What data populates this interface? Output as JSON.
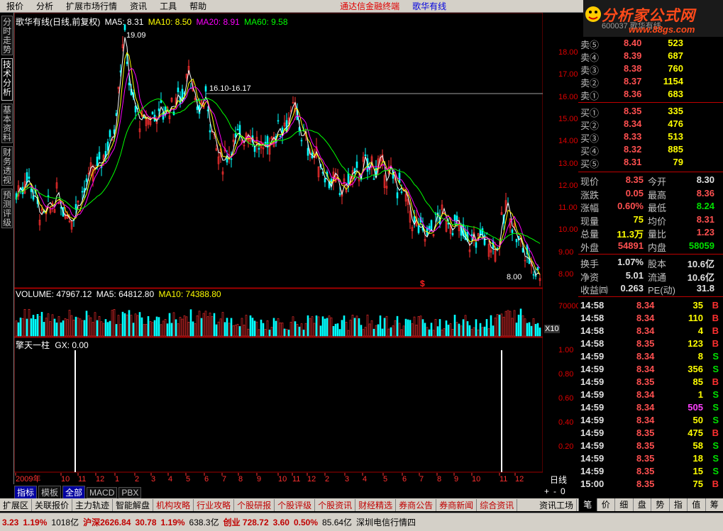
{
  "menu": {
    "items": [
      "报价",
      "分析",
      "扩展市场行情",
      "资讯",
      "工具",
      "帮助"
    ],
    "ad1": "通达信金融终端",
    "ad2": "歌华有线"
  },
  "logo": {
    "main": "分析家公式网",
    "url": "www.88gs.com",
    "sub": "600037 歌华有线"
  },
  "side_tabs": [
    {
      "label": "分时走势"
    },
    {
      "label": "技术分析",
      "active": true
    },
    {
      "label": "基本资料"
    },
    {
      "label": "财务透视"
    },
    {
      "label": "预测评级"
    }
  ],
  "kline": {
    "header_name": "歌华有线(日线,前复权)",
    "ma5": "MA5: 8.31",
    "ma10": "MA10: 8.50",
    "ma20": "MA20: 8.91",
    "ma60": "MA60: 9.58",
    "high_mark": "19.09",
    "range_mark": "16.10-16.17",
    "low_mark": "8.00",
    "colors": {
      "ma5": "#ffffff",
      "ma10": "#ffff00",
      "ma20": "#ff00ff",
      "ma60": "#00ff00",
      "up": "#ff3030",
      "down": "#00ffff"
    },
    "y_ticks": [
      "18.00",
      "17.00",
      "16.00",
      "15.00",
      "14.00",
      "13.00",
      "12.00",
      "11.00",
      "10.00",
      "9.00",
      "8.00"
    ]
  },
  "volume": {
    "label": "VOLUME: 47967.12",
    "ma5": "MA5: 64812.80",
    "ma10": "MA10: 74388.80",
    "tick": "70000",
    "unit": "X10"
  },
  "indicator": {
    "name": "擎天一柱",
    "gx": "GX: 0.00",
    "ticks": [
      "1.00",
      "0.80",
      "0.60",
      "0.40",
      "0.20"
    ]
  },
  "time_axis": {
    "labels": [
      "2009年",
      "10",
      "11",
      "12",
      "1",
      "2",
      "3",
      "4",
      "5",
      "6",
      "7",
      "8",
      "9",
      "10",
      "11",
      "12",
      "2",
      "3",
      "4",
      "5",
      "6",
      "7",
      "8",
      "9",
      "10",
      "11",
      "12"
    ]
  },
  "period": "日线",
  "zoom": [
    "+",
    "-",
    "0"
  ],
  "bottom_tabs": [
    {
      "label": "指标",
      "active": true
    },
    {
      "label": "模板"
    },
    {
      "label": "全部",
      "active": true
    },
    {
      "label": "MACD"
    },
    {
      "label": "PBX"
    }
  ],
  "function_tabs": [
    "扩展区",
    "关联报价",
    "主力轨迹",
    "智能解盘",
    "机构攻略",
    "行业攻略",
    "个股研报",
    "个股评级",
    "个股资讯",
    "财经精选",
    "券商公告",
    "券商新闻",
    "综合资讯",
    "资讯工场"
  ],
  "right_tabs": [
    {
      "label": "笔",
      "active": true
    },
    {
      "label": "价"
    },
    {
      "label": "细"
    },
    {
      "label": "盘"
    },
    {
      "label": "势"
    },
    {
      "label": "指"
    },
    {
      "label": "值"
    },
    {
      "label": "筹"
    }
  ],
  "orderbook": {
    "asks": [
      {
        "label": "卖⑤",
        "price": "8.40",
        "vol": "523"
      },
      {
        "label": "卖④",
        "price": "8.39",
        "vol": "687"
      },
      {
        "label": "卖③",
        "price": "8.38",
        "vol": "760"
      },
      {
        "label": "卖②",
        "price": "8.37",
        "vol": "1154"
      },
      {
        "label": "卖①",
        "price": "8.36",
        "vol": "683"
      }
    ],
    "bids": [
      {
        "label": "买①",
        "price": "8.35",
        "vol": "335"
      },
      {
        "label": "买②",
        "price": "8.34",
        "vol": "476"
      },
      {
        "label": "买③",
        "price": "8.33",
        "vol": "513"
      },
      {
        "label": "买④",
        "price": "8.32",
        "vol": "885"
      },
      {
        "label": "买⑤",
        "price": "8.31",
        "vol": "79"
      }
    ]
  },
  "quote": {
    "rows": [
      {
        "l1": "现价",
        "v1": "8.35",
        "l2": "今开",
        "v2": "8.30",
        "c1": "pr",
        "c2": "wht"
      },
      {
        "l1": "涨跌",
        "v1": "0.05",
        "l2": "最高",
        "v2": "8.36",
        "c1": "pr",
        "c2": "pr"
      },
      {
        "l1": "涨幅",
        "v1": "0.60%",
        "l2": "最低",
        "v2": "8.24",
        "c1": "pr",
        "c2": "grn"
      },
      {
        "l1": "现量",
        "v1": "75",
        "l2": "均价",
        "v2": "8.31",
        "c1": "vol",
        "c2": "pr"
      },
      {
        "l1": "总量",
        "v1": "11.3万",
        "l2": "量比",
        "v2": "1.23",
        "c1": "vol",
        "c2": "pr"
      },
      {
        "l1": "外盘",
        "v1": "54891",
        "l2": "内盘",
        "v2": "58059",
        "c1": "pr",
        "c2": "grn"
      }
    ],
    "rows2": [
      {
        "l1": "换手",
        "v1": "1.07%",
        "l2": "股本",
        "v2": "10.6亿"
      },
      {
        "l1": "净资",
        "v1": "5.01",
        "l2": "流通",
        "v2": "10.6亿"
      },
      {
        "l1": "收益㈣",
        "v1": "0.263",
        "l2": "PE(动)",
        "v2": "31.8"
      }
    ]
  },
  "ticks": [
    {
      "t": "14:58",
      "p": "8.34",
      "v": "35",
      "s": "B",
      "vc": "vol"
    },
    {
      "t": "14:58",
      "p": "8.34",
      "v": "110",
      "s": "B",
      "vc": "vol"
    },
    {
      "t": "14:58",
      "p": "8.34",
      "v": "4",
      "s": "B",
      "vc": "vol"
    },
    {
      "t": "14:58",
      "p": "8.35",
      "v": "123",
      "s": "B",
      "vc": "vol"
    },
    {
      "t": "14:59",
      "p": "8.34",
      "v": "8",
      "s": "S",
      "vc": "vol"
    },
    {
      "t": "14:59",
      "p": "8.34",
      "v": "356",
      "s": "S",
      "vc": "vol"
    },
    {
      "t": "14:59",
      "p": "8.35",
      "v": "85",
      "s": "B",
      "vc": "vol"
    },
    {
      "t": "14:59",
      "p": "8.34",
      "v": "1",
      "s": "S",
      "vc": "vol"
    },
    {
      "t": "14:59",
      "p": "8.34",
      "v": "505",
      "s": "S",
      "vc": "mag"
    },
    {
      "t": "14:59",
      "p": "8.34",
      "v": "50",
      "s": "S",
      "vc": "vol"
    },
    {
      "t": "14:59",
      "p": "8.35",
      "v": "475",
      "s": "B",
      "vc": "vol"
    },
    {
      "t": "14:59",
      "p": "8.35",
      "v": "58",
      "s": "S",
      "vc": "vol"
    },
    {
      "t": "14:59",
      "p": "8.35",
      "v": "18",
      "s": "S",
      "vc": "vol"
    },
    {
      "t": "14:59",
      "p": "8.35",
      "v": "15",
      "s": "S",
      "vc": "vol"
    },
    {
      "t": "15:00",
      "p": "8.35",
      "v": "75",
      "s": "B",
      "vc": "vol"
    }
  ],
  "status": [
    {
      "text": "3.23",
      "cls": "sred"
    },
    {
      "text": "1.19%",
      "cls": "sred"
    },
    {
      "text": "1018亿",
      "cls": "sblk"
    },
    {
      "text": "沪深2626.84",
      "cls": "sred"
    },
    {
      "text": "30.78",
      "cls": "sred"
    },
    {
      "text": "1.19%",
      "cls": "sred"
    },
    {
      "text": "638.3亿",
      "cls": "sblk"
    },
    {
      "text": "创业 728.72",
      "cls": "sred"
    },
    {
      "text": "3.60",
      "cls": "sred"
    },
    {
      "text": "0.50%",
      "cls": "sred"
    },
    {
      "text": "85.64亿",
      "cls": "sblk"
    },
    {
      "text": "深圳电信行情四",
      "cls": "sblk"
    }
  ]
}
